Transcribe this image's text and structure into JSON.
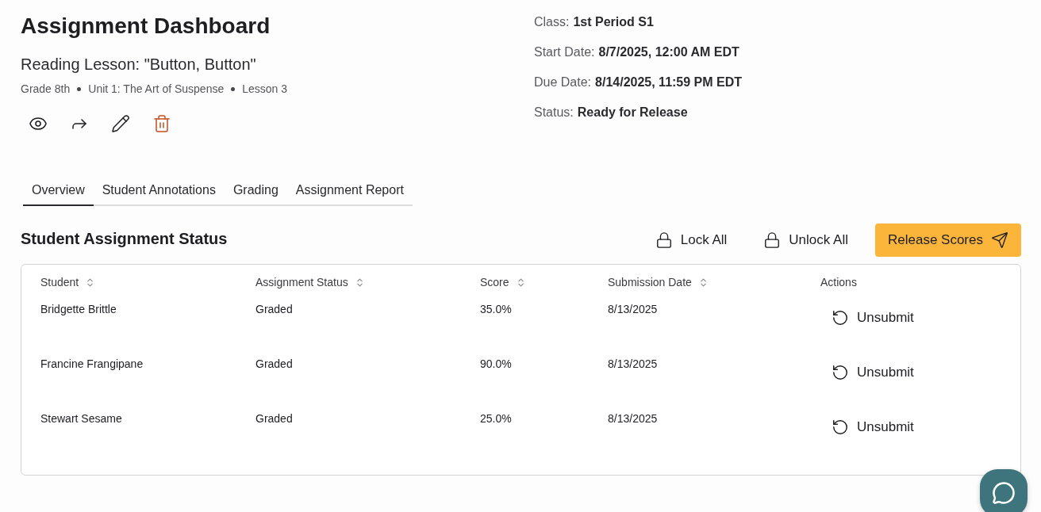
{
  "header": {
    "title": "Assignment Dashboard",
    "subtitle": "Reading Lesson: \"Button, Button\"",
    "meta": [
      "Grade 8th",
      "Unit 1: The Art of Suspense",
      "Lesson 3"
    ]
  },
  "actions": [
    {
      "kind": "view"
    },
    {
      "kind": "share"
    },
    {
      "kind": "edit"
    },
    {
      "kind": "delete"
    }
  ],
  "info": [
    {
      "label": "Class:",
      "value": "1st Period S1"
    },
    {
      "label": "Start Date:",
      "value": "8/7/2025, 12:00 AM EDT"
    },
    {
      "label": "Due Date:",
      "value": "8/14/2025, 11:59 PM EDT"
    },
    {
      "label": "Status:",
      "value": "Ready for Release"
    }
  ],
  "tabs": [
    {
      "label": "Overview",
      "selected": true
    },
    {
      "label": "Student Annotations",
      "selected": false
    },
    {
      "label": "Grading",
      "selected": false
    },
    {
      "label": "Assignment Report",
      "selected": false
    }
  ],
  "section": {
    "title": "Student Assignment Status",
    "buttons": [
      {
        "kind": "lock",
        "label": "Lock All"
      },
      {
        "kind": "unlock",
        "label": "Unlock All"
      },
      {
        "kind": "release",
        "label": "Release Scores"
      }
    ]
  },
  "table": {
    "columns": [
      {
        "label": "Student",
        "sortable": true
      },
      {
        "label": "Assignment Status",
        "sortable": true
      },
      {
        "label": "Score",
        "sortable": true
      },
      {
        "label": "Submission Date",
        "sortable": true
      },
      {
        "label": "Actions",
        "sortable": false
      }
    ],
    "rows": [
      {
        "student": "Bridgette Brittle",
        "status": "Graded",
        "score": "35.0%",
        "date": "8/13/2025",
        "action": "Unsubmit"
      },
      {
        "student": "Francine Frangipane",
        "status": "Graded",
        "score": "90.0%",
        "date": "8/13/2025",
        "action": "Unsubmit"
      },
      {
        "student": "Stewart Sesame",
        "status": "Graded",
        "score": "25.0%",
        "date": "8/13/2025",
        "action": "Unsubmit"
      }
    ]
  }
}
